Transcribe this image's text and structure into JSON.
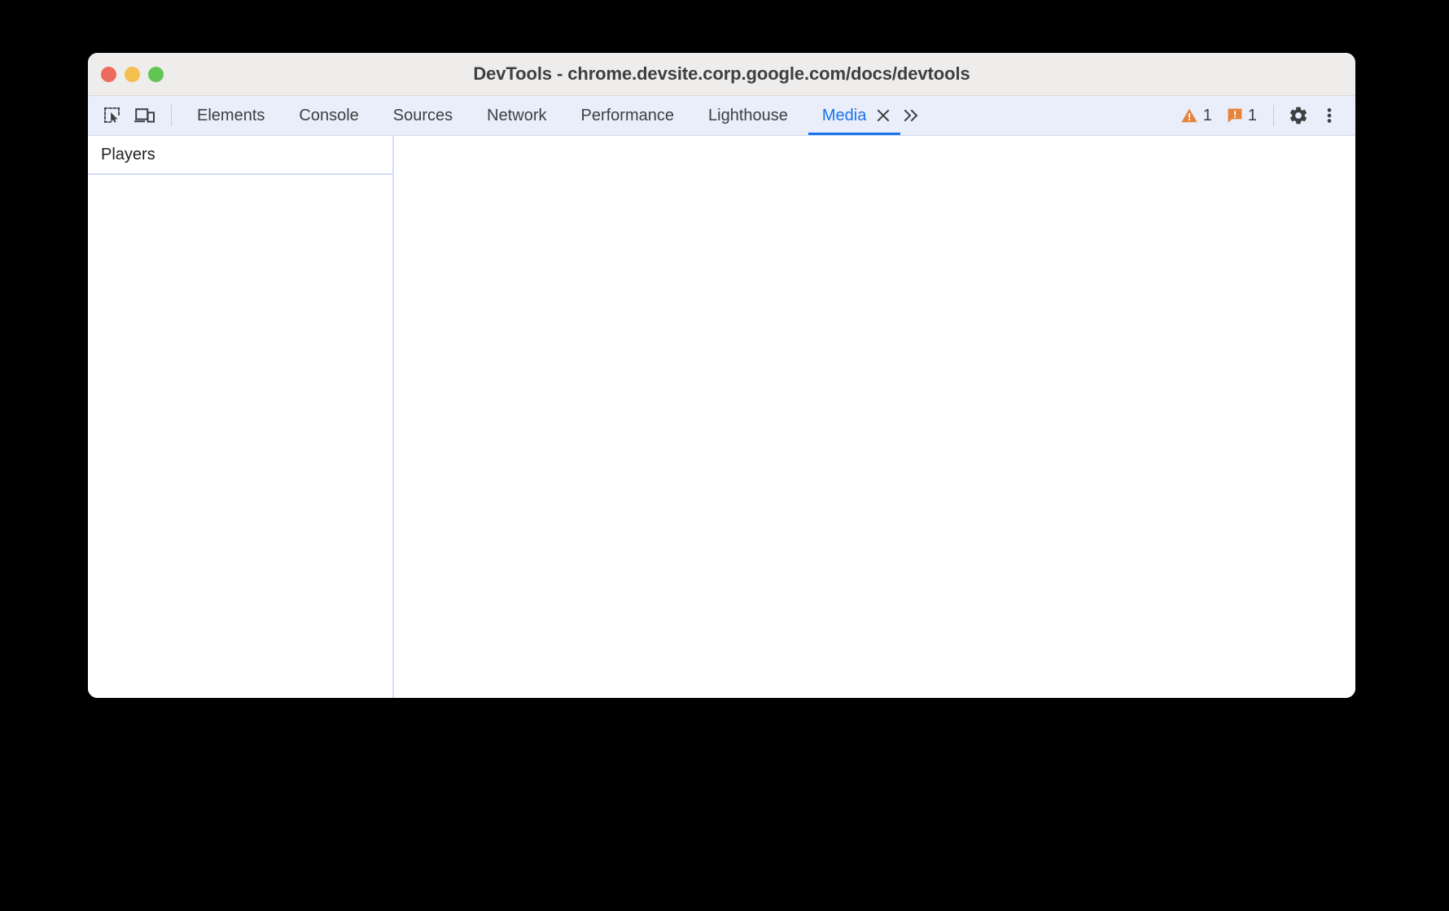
{
  "window": {
    "title": "DevTools - chrome.devsite.corp.google.com/docs/devtools",
    "traffic_lights": {
      "close_label": "close-window",
      "minimize_label": "minimize-window",
      "maximize_label": "maximize-window",
      "close_color": "#ec6a5e",
      "minimize_color": "#f4bf4f",
      "maximize_color": "#61c554"
    }
  },
  "toolbar": {
    "inspect_icon": "inspect-element-icon",
    "device_icon": "device-toolbar-icon",
    "tabs": [
      {
        "label": "Elements",
        "active": false
      },
      {
        "label": "Console",
        "active": false
      },
      {
        "label": "Sources",
        "active": false
      },
      {
        "label": "Network",
        "active": false
      },
      {
        "label": "Performance",
        "active": false
      },
      {
        "label": "Lighthouse",
        "active": false
      },
      {
        "label": "Media",
        "active": true
      }
    ],
    "close_tab_icon": "close-icon",
    "overflow_icon": "chevron-double-right-icon",
    "warnings": {
      "icon": "warning-triangle-icon",
      "count": "1",
      "color": "#e8833a"
    },
    "issues": {
      "icon": "issue-badge-icon",
      "count": "1",
      "color": "#e8833a"
    },
    "settings_icon": "gear-icon",
    "more_icon": "kebab-menu-icon",
    "accent_color": "#1a73e8"
  },
  "panel": {
    "sidebar_title": "Players",
    "players": []
  }
}
